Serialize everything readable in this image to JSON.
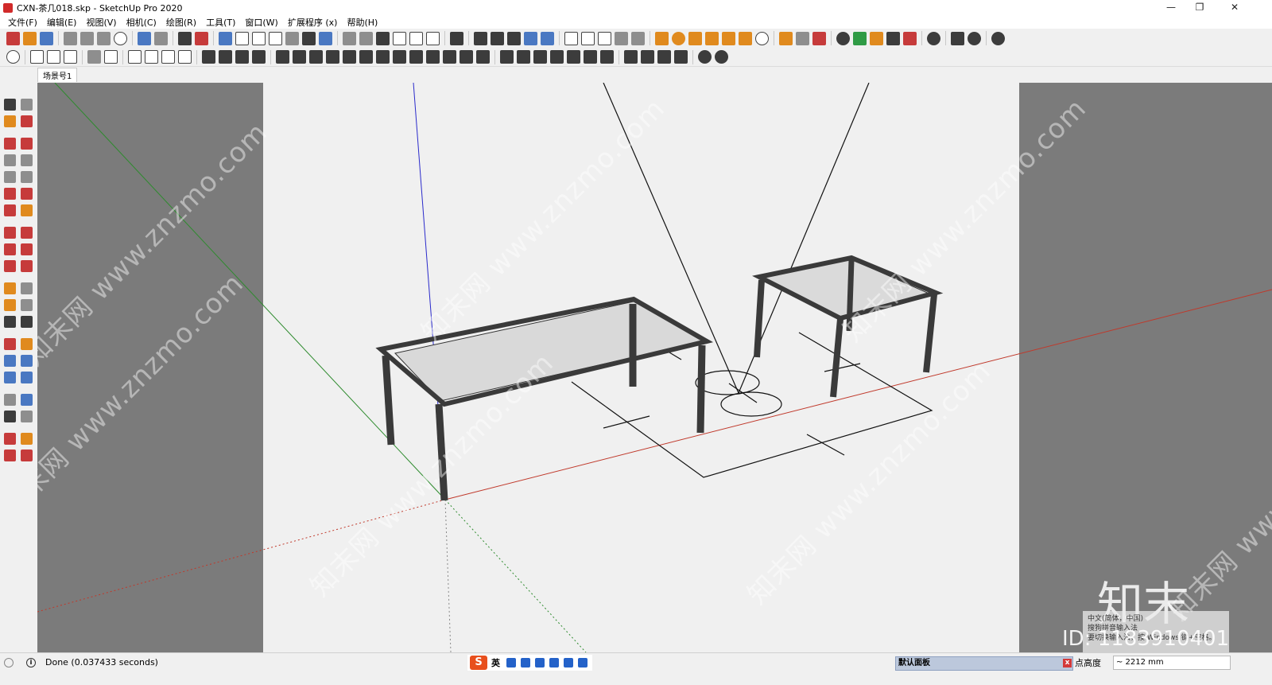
{
  "window": {
    "title": "CXN-茶几018.skp - SketchUp Pro 2020",
    "minimize": "—",
    "maximize": "❐",
    "close": "✕"
  },
  "menu": [
    "文件(F)",
    "编辑(E)",
    "视图(V)",
    "相机(C)",
    "绘图(R)",
    "工具(T)",
    "窗口(W)",
    "扩展程序 (x)",
    "帮助(H)"
  ],
  "scene_tab": "场景号1",
  "watermark": {
    "text": "知末网 www.znzmo.com",
    "logo": "知末",
    "id": "ID: 1183910401"
  },
  "ime_popup": {
    "line1": "中文(简体，中国)",
    "line2": "搜狗拼音输入法",
    "line3": "要切换输入法，按 Windows 键+空格。"
  },
  "statusbar": {
    "status": "Done (0.037433 seconds)",
    "ime_lang": "英",
    "ime_logo": "S",
    "panel_title": "默认面板",
    "panel_close": "x",
    "vcb_label": "点高度",
    "vcb_value": "~ 2212 mm"
  },
  "colors": {
    "axis_red": "#c0392b",
    "axis_green": "#2e8b2e",
    "axis_blue": "#2a2acb",
    "viewport_bg": "#7b7b7b",
    "canvas_bg": "#f0f0f0"
  }
}
